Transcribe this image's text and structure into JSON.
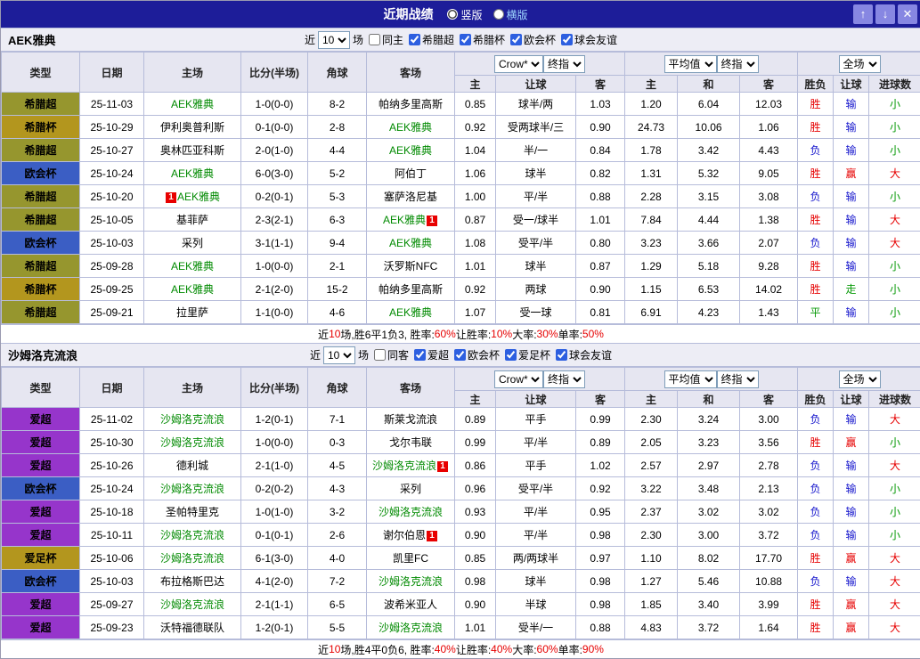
{
  "header": {
    "title": "近期战绩",
    "vertical_label": "竖版",
    "horizontal_label": "横版",
    "vertical_checked": true,
    "horizontal_checked": false,
    "btn_up": "↑",
    "btn_down": "↓",
    "btn_close": "✕"
  },
  "table_header": {
    "type": "类型",
    "date": "日期",
    "home": "主场",
    "score": "比分(半场)",
    "corner": "角球",
    "away": "客场",
    "ah_book": "Crow*",
    "ah_final": "终指",
    "eu_avg": "平均值",
    "eu_final": "终指",
    "full": "全场",
    "sub": [
      "主",
      "让球",
      "客",
      "主",
      "和",
      "客",
      "胜负",
      "让球",
      "进球数"
    ]
  },
  "colors": {
    "topbar_bg": "#1d1d99",
    "focus_team": "#018a01",
    "badge_bg": "#e80000",
    "result": {
      "r": "#e60000",
      "b": "#1414cc",
      "g": "#089a08",
      "k": "#000000"
    }
  },
  "league_colors": {
    "希腊超": "#96962e",
    "希腊杯": "#b3961e",
    "欧会杯": "#3b5ec4",
    "爱超": "#9635cb",
    "爱足杯": "#b3961e"
  },
  "sections": [
    {
      "team": "AEK雅典",
      "filter": {
        "near_label": "近",
        "count": "10",
        "games_label": "场",
        "same_label": "同主",
        "same_checked": false,
        "leagues": [
          "希腊超",
          "希腊杯",
          "欧会杯",
          "球会友谊"
        ],
        "leagues_checked": [
          true,
          true,
          true,
          true
        ]
      },
      "rows": [
        {
          "league": "希腊超",
          "date": "25-11-03",
          "home": {
            "name": "AEK雅典",
            "focus": true,
            "badge": ""
          },
          "score": "1-0(0-0)",
          "corner": "8-2",
          "away": {
            "name": "帕纳多里高斯",
            "focus": false,
            "badge": ""
          },
          "ah": [
            "0.85",
            "球半/两",
            "1.03"
          ],
          "eu": [
            "1.20",
            "6.04",
            "12.03"
          ],
          "res": [
            {
              "t": "胜",
              "c": "r"
            },
            {
              "t": "输",
              "c": "b"
            },
            {
              "t": "小",
              "c": "g"
            }
          ]
        },
        {
          "league": "希腊杯",
          "date": "25-10-29",
          "home": {
            "name": "伊利奥普利斯",
            "focus": false,
            "badge": ""
          },
          "score": "0-1(0-0)",
          "corner": "2-8",
          "away": {
            "name": "AEK雅典",
            "focus": true,
            "badge": ""
          },
          "ah": [
            "0.92",
            "受两球半/三",
            "0.90"
          ],
          "eu": [
            "24.73",
            "10.06",
            "1.06"
          ],
          "res": [
            {
              "t": "胜",
              "c": "r"
            },
            {
              "t": "输",
              "c": "b"
            },
            {
              "t": "小",
              "c": "g"
            }
          ]
        },
        {
          "league": "希腊超",
          "date": "25-10-27",
          "home": {
            "name": "奥林匹亚科斯",
            "focus": false,
            "badge": ""
          },
          "score": "2-0(1-0)",
          "corner": "4-4",
          "away": {
            "name": "AEK雅典",
            "focus": true,
            "badge": ""
          },
          "ah": [
            "1.04",
            "半/一",
            "0.84"
          ],
          "eu": [
            "1.78",
            "3.42",
            "4.43"
          ],
          "res": [
            {
              "t": "负",
              "c": "b"
            },
            {
              "t": "输",
              "c": "b"
            },
            {
              "t": "小",
              "c": "g"
            }
          ]
        },
        {
          "league": "欧会杯",
          "date": "25-10-24",
          "home": {
            "name": "AEK雅典",
            "focus": true,
            "badge": ""
          },
          "score": "6-0(3-0)",
          "corner": "5-2",
          "away": {
            "name": "阿伯丁",
            "focus": false,
            "badge": ""
          },
          "ah": [
            "1.06",
            "球半",
            "0.82"
          ],
          "eu": [
            "1.31",
            "5.32",
            "9.05"
          ],
          "res": [
            {
              "t": "胜",
              "c": "r"
            },
            {
              "t": "赢",
              "c": "r"
            },
            {
              "t": "大",
              "c": "r"
            }
          ]
        },
        {
          "league": "希腊超",
          "date": "25-10-20",
          "home": {
            "name": "AEK雅典",
            "focus": true,
            "badge": "L"
          },
          "score": "0-2(0-1)",
          "corner": "5-3",
          "away": {
            "name": "塞萨洛尼基",
            "focus": false,
            "badge": ""
          },
          "ah": [
            "1.00",
            "平/半",
            "0.88"
          ],
          "eu": [
            "2.28",
            "3.15",
            "3.08"
          ],
          "res": [
            {
              "t": "负",
              "c": "b"
            },
            {
              "t": "输",
              "c": "b"
            },
            {
              "t": "小",
              "c": "g"
            }
          ]
        },
        {
          "league": "希腊超",
          "date": "25-10-05",
          "home": {
            "name": "基菲萨",
            "focus": false,
            "badge": ""
          },
          "score": "2-3(2-1)",
          "corner": "6-3",
          "away": {
            "name": "AEK雅典",
            "focus": true,
            "badge": "R"
          },
          "ah": [
            "0.87",
            "受一/球半",
            "1.01"
          ],
          "eu": [
            "7.84",
            "4.44",
            "1.38"
          ],
          "res": [
            {
              "t": "胜",
              "c": "r"
            },
            {
              "t": "输",
              "c": "b"
            },
            {
              "t": "大",
              "c": "r"
            }
          ]
        },
        {
          "league": "欧会杯",
          "date": "25-10-03",
          "home": {
            "name": "采列",
            "focus": false,
            "badge": ""
          },
          "score": "3-1(1-1)",
          "corner": "9-4",
          "away": {
            "name": "AEK雅典",
            "focus": true,
            "badge": ""
          },
          "ah": [
            "1.08",
            "受平/半",
            "0.80"
          ],
          "eu": [
            "3.23",
            "3.66",
            "2.07"
          ],
          "res": [
            {
              "t": "负",
              "c": "b"
            },
            {
              "t": "输",
              "c": "b"
            },
            {
              "t": "大",
              "c": "r"
            }
          ]
        },
        {
          "league": "希腊超",
          "date": "25-09-28",
          "home": {
            "name": "AEK雅典",
            "focus": true,
            "badge": ""
          },
          "score": "1-0(0-0)",
          "corner": "2-1",
          "away": {
            "name": "沃罗斯NFC",
            "focus": false,
            "badge": ""
          },
          "ah": [
            "1.01",
            "球半",
            "0.87"
          ],
          "eu": [
            "1.29",
            "5.18",
            "9.28"
          ],
          "res": [
            {
              "t": "胜",
              "c": "r"
            },
            {
              "t": "输",
              "c": "b"
            },
            {
              "t": "小",
              "c": "g"
            }
          ]
        },
        {
          "league": "希腊杯",
          "date": "25-09-25",
          "home": {
            "name": "AEK雅典",
            "focus": true,
            "badge": ""
          },
          "score": "2-1(2-0)",
          "corner": "15-2",
          "away": {
            "name": "帕纳多里高斯",
            "focus": false,
            "badge": ""
          },
          "ah": [
            "0.92",
            "两球",
            "0.90"
          ],
          "eu": [
            "1.15",
            "6.53",
            "14.02"
          ],
          "res": [
            {
              "t": "胜",
              "c": "r"
            },
            {
              "t": "走",
              "c": "g"
            },
            {
              "t": "小",
              "c": "g"
            }
          ]
        },
        {
          "league": "希腊超",
          "date": "25-09-21",
          "home": {
            "name": "拉里萨",
            "focus": false,
            "badge": ""
          },
          "score": "1-1(0-0)",
          "corner": "4-6",
          "away": {
            "name": "AEK雅典",
            "focus": true,
            "badge": ""
          },
          "ah": [
            "1.07",
            "受一球",
            "0.81"
          ],
          "eu": [
            "6.91",
            "4.23",
            "1.43"
          ],
          "res": [
            {
              "t": "平",
              "c": "g"
            },
            {
              "t": "输",
              "c": "b"
            },
            {
              "t": "小",
              "c": "g"
            }
          ]
        }
      ],
      "summary": [
        {
          "t": "近",
          "c": "k"
        },
        {
          "t": "10",
          "c": "r"
        },
        {
          "t": "场,胜6平1负3, 胜率:",
          "c": "k"
        },
        {
          "t": "60%",
          "c": "r"
        },
        {
          "t": " 让胜率:",
          "c": "k"
        },
        {
          "t": "10%",
          "c": "r"
        },
        {
          "t": " 大率:",
          "c": "k"
        },
        {
          "t": "30%",
          "c": "r"
        },
        {
          "t": " 单率:",
          "c": "k"
        },
        {
          "t": "50%",
          "c": "r"
        }
      ]
    },
    {
      "team": "沙姆洛克流浪",
      "filter": {
        "near_label": "近",
        "count": "10",
        "games_label": "场",
        "same_label": "同客",
        "same_checked": false,
        "leagues": [
          "爱超",
          "欧会杯",
          "爱足杯",
          "球会友谊"
        ],
        "leagues_checked": [
          true,
          true,
          true,
          true
        ]
      },
      "rows": [
        {
          "league": "爱超",
          "date": "25-11-02",
          "home": {
            "name": "沙姆洛克流浪",
            "focus": true,
            "badge": ""
          },
          "score": "1-2(0-1)",
          "corner": "7-1",
          "away": {
            "name": "斯莱戈流浪",
            "focus": false,
            "badge": ""
          },
          "ah": [
            "0.89",
            "平手",
            "0.99"
          ],
          "eu": [
            "2.30",
            "3.24",
            "3.00"
          ],
          "res": [
            {
              "t": "负",
              "c": "b"
            },
            {
              "t": "输",
              "c": "b"
            },
            {
              "t": "大",
              "c": "r"
            }
          ]
        },
        {
          "league": "爱超",
          "date": "25-10-30",
          "home": {
            "name": "沙姆洛克流浪",
            "focus": true,
            "badge": ""
          },
          "score": "1-0(0-0)",
          "corner": "0-3",
          "away": {
            "name": "戈尔韦联",
            "focus": false,
            "badge": ""
          },
          "ah": [
            "0.99",
            "平/半",
            "0.89"
          ],
          "eu": [
            "2.05",
            "3.23",
            "3.56"
          ],
          "res": [
            {
              "t": "胜",
              "c": "r"
            },
            {
              "t": "赢",
              "c": "r"
            },
            {
              "t": "小",
              "c": "g"
            }
          ]
        },
        {
          "league": "爱超",
          "date": "25-10-26",
          "home": {
            "name": "德利城",
            "focus": false,
            "badge": ""
          },
          "score": "2-1(1-0)",
          "corner": "4-5",
          "away": {
            "name": "沙姆洛克流浪",
            "focus": true,
            "badge": "R"
          },
          "ah": [
            "0.86",
            "平手",
            "1.02"
          ],
          "eu": [
            "2.57",
            "2.97",
            "2.78"
          ],
          "res": [
            {
              "t": "负",
              "c": "b"
            },
            {
              "t": "输",
              "c": "b"
            },
            {
              "t": "大",
              "c": "r"
            }
          ]
        },
        {
          "league": "欧会杯",
          "date": "25-10-24",
          "home": {
            "name": "沙姆洛克流浪",
            "focus": true,
            "badge": ""
          },
          "score": "0-2(0-2)",
          "corner": "4-3",
          "away": {
            "name": "采列",
            "focus": false,
            "badge": ""
          },
          "ah": [
            "0.96",
            "受平/半",
            "0.92"
          ],
          "eu": [
            "3.22",
            "3.48",
            "2.13"
          ],
          "res": [
            {
              "t": "负",
              "c": "b"
            },
            {
              "t": "输",
              "c": "b"
            },
            {
              "t": "小",
              "c": "g"
            }
          ]
        },
        {
          "league": "爱超",
          "date": "25-10-18",
          "home": {
            "name": "圣帕特里克",
            "focus": false,
            "badge": ""
          },
          "score": "1-0(1-0)",
          "corner": "3-2",
          "away": {
            "name": "沙姆洛克流浪",
            "focus": true,
            "badge": ""
          },
          "ah": [
            "0.93",
            "平/半",
            "0.95"
          ],
          "eu": [
            "2.37",
            "3.02",
            "3.02"
          ],
          "res": [
            {
              "t": "负",
              "c": "b"
            },
            {
              "t": "输",
              "c": "b"
            },
            {
              "t": "小",
              "c": "g"
            }
          ]
        },
        {
          "league": "爱超",
          "date": "25-10-11",
          "home": {
            "name": "沙姆洛克流浪",
            "focus": true,
            "badge": ""
          },
          "score": "0-1(0-1)",
          "corner": "2-6",
          "away": {
            "name": "谢尔伯恩",
            "focus": false,
            "badge": "R"
          },
          "ah": [
            "0.90",
            "平/半",
            "0.98"
          ],
          "eu": [
            "2.30",
            "3.00",
            "3.72"
          ],
          "res": [
            {
              "t": "负",
              "c": "b"
            },
            {
              "t": "输",
              "c": "b"
            },
            {
              "t": "小",
              "c": "g"
            }
          ]
        },
        {
          "league": "爱足杯",
          "date": "25-10-06",
          "home": {
            "name": "沙姆洛克流浪",
            "focus": true,
            "badge": ""
          },
          "score": "6-1(3-0)",
          "corner": "4-0",
          "away": {
            "name": "凯里FC",
            "focus": false,
            "badge": ""
          },
          "ah": [
            "0.85",
            "两/两球半",
            "0.97"
          ],
          "eu": [
            "1.10",
            "8.02",
            "17.70"
          ],
          "res": [
            {
              "t": "胜",
              "c": "r"
            },
            {
              "t": "赢",
              "c": "r"
            },
            {
              "t": "大",
              "c": "r"
            }
          ]
        },
        {
          "league": "欧会杯",
          "date": "25-10-03",
          "home": {
            "name": "布拉格斯巴达",
            "focus": false,
            "badge": ""
          },
          "score": "4-1(2-0)",
          "corner": "7-2",
          "away": {
            "name": "沙姆洛克流浪",
            "focus": true,
            "badge": ""
          },
          "ah": [
            "0.98",
            "球半",
            "0.98"
          ],
          "eu": [
            "1.27",
            "5.46",
            "10.88"
          ],
          "res": [
            {
              "t": "负",
              "c": "b"
            },
            {
              "t": "输",
              "c": "b"
            },
            {
              "t": "大",
              "c": "r"
            }
          ]
        },
        {
          "league": "爱超",
          "date": "25-09-27",
          "home": {
            "name": "沙姆洛克流浪",
            "focus": true,
            "badge": ""
          },
          "score": "2-1(1-1)",
          "corner": "6-5",
          "away": {
            "name": "波希米亚人",
            "focus": false,
            "badge": ""
          },
          "ah": [
            "0.90",
            "半球",
            "0.98"
          ],
          "eu": [
            "1.85",
            "3.40",
            "3.99"
          ],
          "res": [
            {
              "t": "胜",
              "c": "r"
            },
            {
              "t": "赢",
              "c": "r"
            },
            {
              "t": "大",
              "c": "r"
            }
          ]
        },
        {
          "league": "爱超",
          "date": "25-09-23",
          "home": {
            "name": "沃特福德联队",
            "focus": false,
            "badge": ""
          },
          "score": "1-2(0-1)",
          "corner": "5-5",
          "away": {
            "name": "沙姆洛克流浪",
            "focus": true,
            "badge": ""
          },
          "ah": [
            "1.01",
            "受半/一",
            "0.88"
          ],
          "eu": [
            "4.83",
            "3.72",
            "1.64"
          ],
          "res": [
            {
              "t": "胜",
              "c": "r"
            },
            {
              "t": "赢",
              "c": "r"
            },
            {
              "t": "大",
              "c": "r"
            }
          ]
        }
      ],
      "summary": [
        {
          "t": "近",
          "c": "k"
        },
        {
          "t": "10",
          "c": "r"
        },
        {
          "t": "场,胜4平0负6, 胜率:",
          "c": "k"
        },
        {
          "t": "40%",
          "c": "r"
        },
        {
          "t": " 让胜率:",
          "c": "k"
        },
        {
          "t": "40%",
          "c": "r"
        },
        {
          "t": " 大率:",
          "c": "k"
        },
        {
          "t": "60%",
          "c": "r"
        },
        {
          "t": " 单率:",
          "c": "k"
        },
        {
          "t": "90%",
          "c": "r"
        }
      ]
    }
  ]
}
